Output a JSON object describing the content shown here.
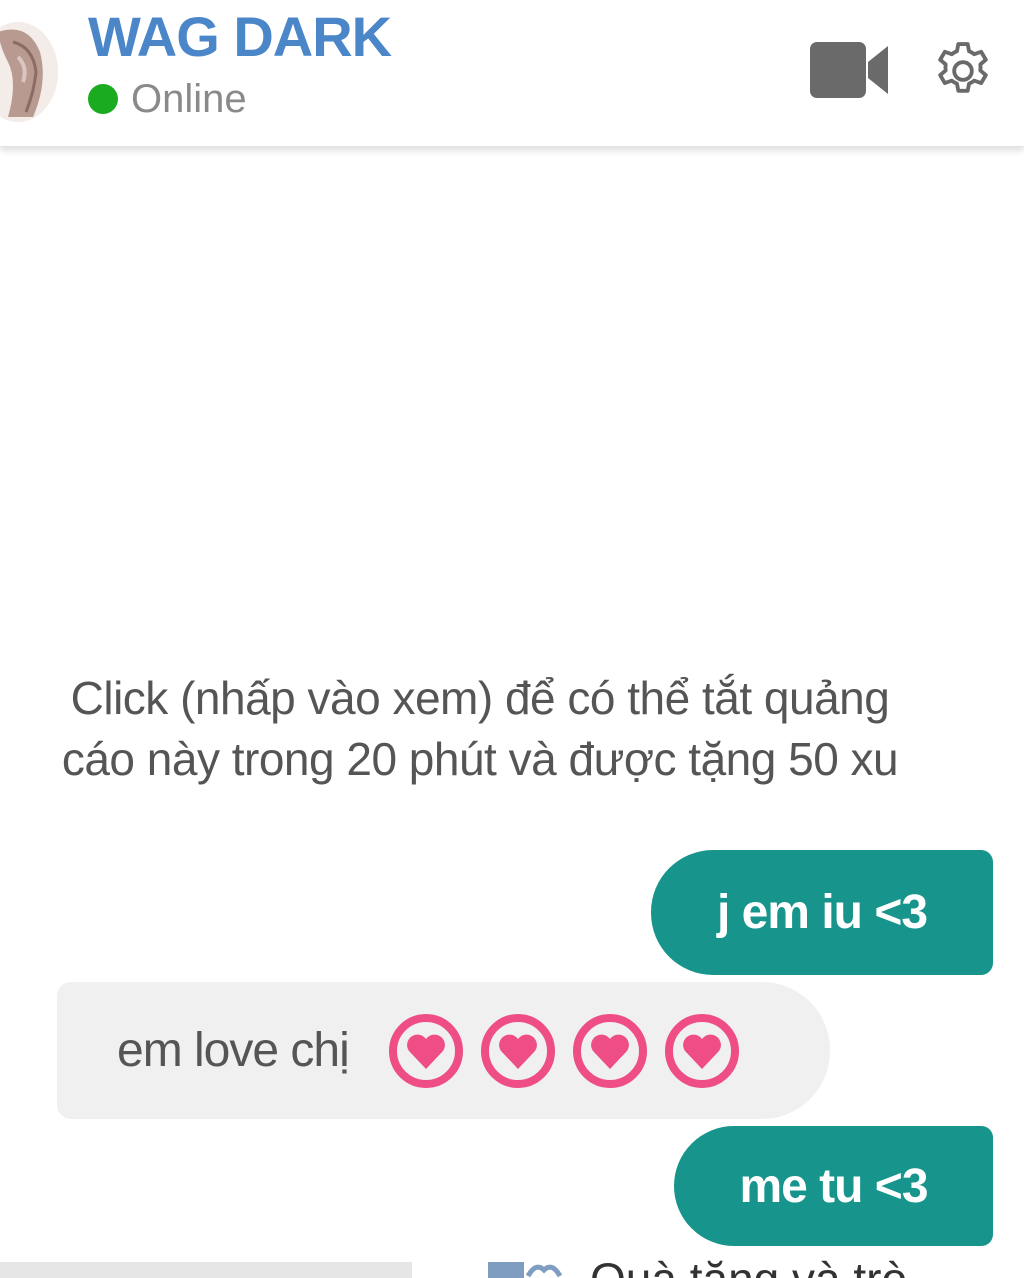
{
  "header": {
    "contact_name": "WAG DARK",
    "status": "Online",
    "status_color": "#1aab20",
    "name_color": "#4a86c8",
    "icons": [
      "avatar",
      "video-camera-icon",
      "gear-icon"
    ]
  },
  "chat": {
    "ad_notice": "Click (nhấp vào xem) để có thể tắt quảng cáo này trong 20 phút và được tặng 50 xu",
    "messages": [
      {
        "direction": "outgoing",
        "text": "j em iu <3"
      },
      {
        "direction": "incoming",
        "text": "em love chị",
        "emoji": [
          "heart-icon",
          "heart-icon",
          "heart-icon",
          "heart-icon"
        ]
      },
      {
        "direction": "outgoing",
        "text": "me tu <3"
      }
    ],
    "outgoing_color": "#17958c",
    "incoming_color": "#f0f0f0"
  },
  "footer": {
    "gift_label": "Quà tặng và trò"
  }
}
